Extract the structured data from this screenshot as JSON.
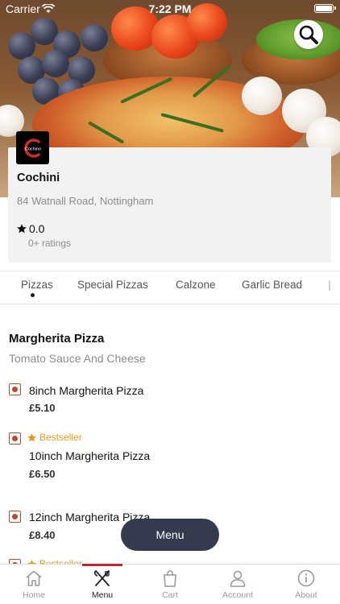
{
  "status_bar": {
    "carrier": "Carrier",
    "time": "7:22 PM"
  },
  "restaurant": {
    "logo_text": "Cochino",
    "name": "Cochini",
    "address": "84 Watnall Road, Nottingham",
    "rating": "0.0",
    "ratings_count": "0+ ratings"
  },
  "categories": {
    "items": [
      "Pizzas",
      "Special Pizzas",
      "Calzone",
      "Garlic Bread"
    ],
    "active": "Pizzas"
  },
  "section": {
    "title": "Margherita Pizza",
    "description": "Tomato Sauce And Cheese",
    "items": [
      {
        "name": "8inch Margherita Pizza",
        "price": "£5.10",
        "badge": ""
      },
      {
        "name": "10inch Margherita Pizza",
        "price": "£6.50",
        "badge": "Bestseller"
      },
      {
        "name": "12inch Margherita Pizza",
        "price": "£8.40",
        "badge": ""
      },
      {
        "name": "",
        "price": "",
        "badge": "Bestseller"
      }
    ]
  },
  "floating_button": {
    "label": "Menu"
  },
  "tab_bar": {
    "items": [
      {
        "label": "Home",
        "icon": "home-icon"
      },
      {
        "label": "Menu",
        "icon": "fork-knife-icon"
      },
      {
        "label": "Cart",
        "icon": "bag-icon"
      },
      {
        "label": "Account",
        "icon": "person-icon"
      },
      {
        "label": "About",
        "icon": "info-icon"
      }
    ],
    "active": "Menu"
  },
  "colors": {
    "accent": "#c0282d",
    "bestseller": "#e39a1f",
    "veg_marker": "#b84a2b",
    "menu_button": "#353a4f"
  }
}
